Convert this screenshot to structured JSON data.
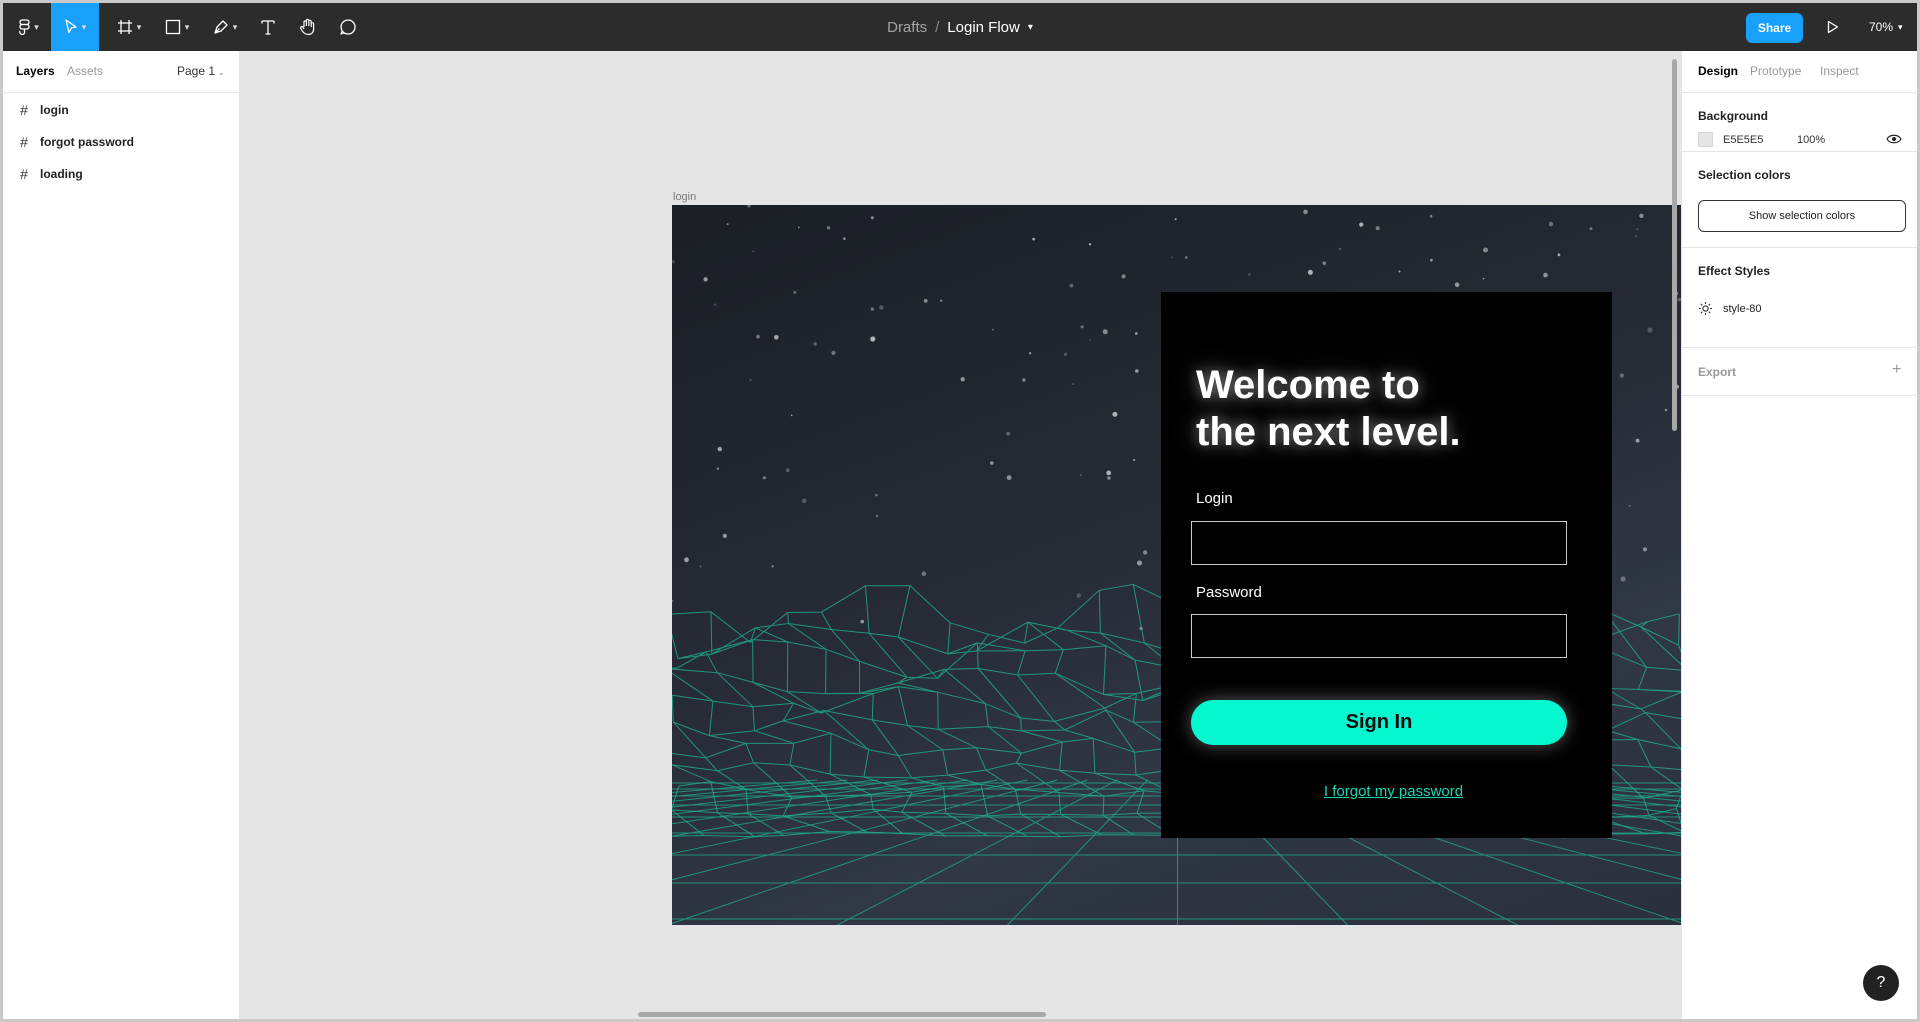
{
  "toolbar": {
    "breadcrumb_parent": "Drafts",
    "breadcrumb_separator": "/",
    "file_name": "Login Flow",
    "share_label": "Share",
    "zoom": "70%",
    "icons": [
      "figma-menu-icon",
      "move-tool-icon",
      "frame-tool-icon",
      "shape-tool-icon",
      "pen-tool-icon",
      "text-tool-icon",
      "hand-tool-icon",
      "comment-tool-icon",
      "play-icon"
    ]
  },
  "left_panel": {
    "tabs": [
      {
        "label": "Layers",
        "active": true
      },
      {
        "label": "Assets",
        "active": false
      }
    ],
    "page_selector": "Page 1",
    "layers": [
      {
        "name": "login"
      },
      {
        "name": "forgot password"
      },
      {
        "name": "loading"
      }
    ]
  },
  "canvas": {
    "frame_label": "login",
    "card": {
      "headline_line1": "Welcome to",
      "headline_line2": "the next level.",
      "login_label": "Login",
      "login_value": "",
      "password_label": "Password",
      "password_value": "",
      "signin_label": "Sign In",
      "forgot_link": "I forgot my password"
    },
    "colors": {
      "accent": "#05F7D0",
      "grid": "#1FB896",
      "card": "#000000"
    }
  },
  "right_panel": {
    "tabs": [
      {
        "label": "Design",
        "active": true
      },
      {
        "label": "Prototype",
        "active": false
      },
      {
        "label": "Inspect",
        "active": false
      }
    ],
    "background": {
      "title": "Background",
      "hex": "E5E5E5",
      "opacity": "100%"
    },
    "selection_colors": {
      "title": "Selection colors",
      "button_label": "Show selection colors"
    },
    "effect_styles": {
      "title": "Effect Styles",
      "style_name": "style-80"
    },
    "export": {
      "title": "Export",
      "plus": "+"
    }
  },
  "help_label": "?"
}
